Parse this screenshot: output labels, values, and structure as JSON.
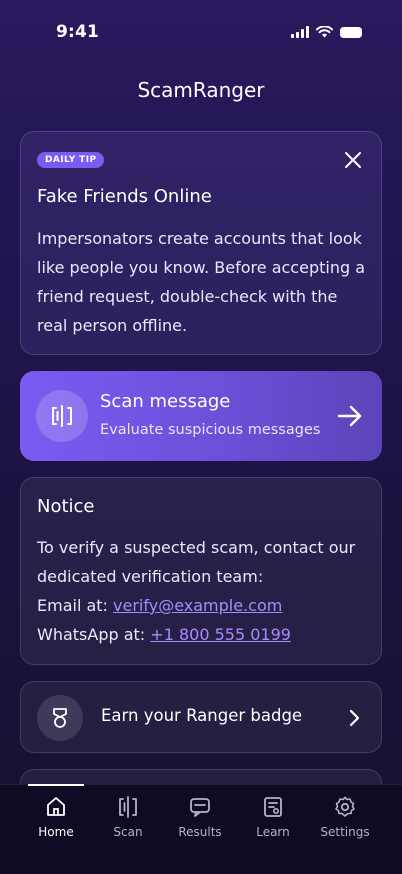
{
  "status_bar": {
    "time": "9:41"
  },
  "app": {
    "title": "ScamRanger"
  },
  "daily_tip": {
    "badge": "DAILY TIP",
    "title": "Fake Friends Online",
    "body": "Impersonators create accounts that look like people you know. Before accepting a friend request, double-check with the real person offline."
  },
  "scan_card": {
    "title": "Scan message",
    "subtitle": "Evaluate suspicious messages"
  },
  "notice": {
    "title": "Notice",
    "body": "To verify a suspected scam, contact our dedicated verification team:",
    "email_label": "Email at: ",
    "email": "verify@example.com",
    "whatsapp_label": "WhatsApp at: ",
    "whatsapp": "+1 800 555 0199"
  },
  "badge_card": {
    "label": "Earn your Ranger badge"
  },
  "tabs": [
    {
      "label": "Home",
      "icon": "home-icon",
      "active": true
    },
    {
      "label": "Scan",
      "icon": "scan-icon"
    },
    {
      "label": "Results",
      "icon": "results-icon"
    },
    {
      "label": "Learn",
      "icon": "learn-icon"
    },
    {
      "label": "Settings",
      "icon": "gear-icon"
    }
  ],
  "colors": {
    "accent": "#7b5cf0",
    "link": "#a98bff",
    "tabbar": "#0f0b24"
  }
}
